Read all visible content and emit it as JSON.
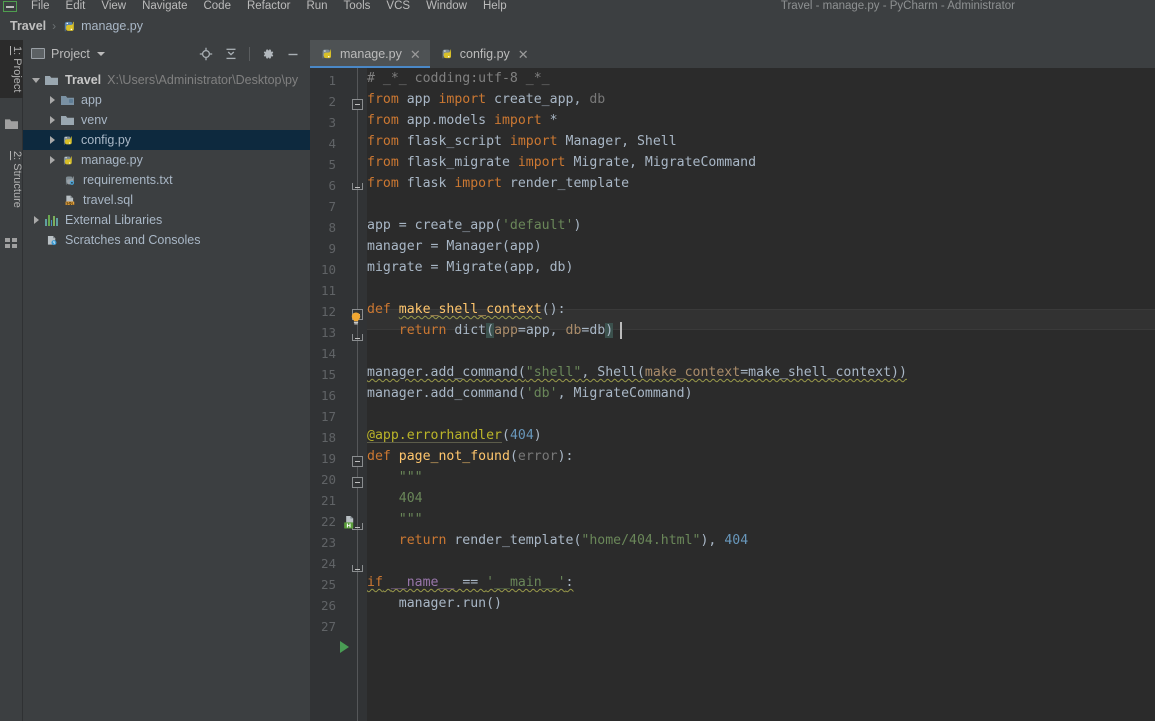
{
  "window": {
    "title": "Travel - manage.py - PyCharm - Administrator",
    "menu_items": [
      "File",
      "Edit",
      "View",
      "Navigate",
      "Code",
      "Refactor",
      "Run",
      "Tools",
      "VCS",
      "Window",
      "Help"
    ]
  },
  "breadcrumb": {
    "project": "Travel",
    "separator": "›",
    "file": "manage.py"
  },
  "tool_tabs": [
    {
      "number": "1:",
      "label": " Project",
      "active": true
    },
    {
      "number": "2:",
      "label": " Structure",
      "active": false
    }
  ],
  "project_panel": {
    "title": "Project",
    "actions": [
      {
        "name": "locate-icon",
        "tooltip": "Select Opened File"
      },
      {
        "name": "collapse-all-icon",
        "tooltip": "Collapse All"
      },
      {
        "name": "settings-gear-icon",
        "tooltip": "Settings"
      },
      {
        "name": "hide-icon",
        "tooltip": "Hide"
      }
    ],
    "tree": [
      {
        "label": "Travel",
        "path": "X:\\Users\\Administrator\\Desktop\\py",
        "icon": "folder-icon",
        "expanded": true,
        "depth": 0,
        "bold": true,
        "selected": false
      },
      {
        "label": "app",
        "icon": "module-folder-icon",
        "expanded": false,
        "depth": 1,
        "bold": false,
        "selected": false
      },
      {
        "label": "venv",
        "icon": "folder-icon",
        "expanded": false,
        "depth": 1,
        "bold": false,
        "selected": false
      },
      {
        "label": "config.py",
        "icon": "python-file-icon",
        "expanded": false,
        "depth": 1,
        "bold": false,
        "selected": true
      },
      {
        "label": "manage.py",
        "icon": "python-file-icon",
        "expanded": false,
        "depth": 1,
        "bold": false,
        "selected": false
      },
      {
        "label": "requirements.txt",
        "icon": "requirements-file-icon",
        "expanded": null,
        "depth": 1,
        "bold": false,
        "selected": false
      },
      {
        "label": "travel.sql",
        "icon": "sql-file-icon",
        "expanded": null,
        "depth": 1,
        "bold": false,
        "selected": false
      },
      {
        "label": "External Libraries",
        "icon": "library-icon",
        "expanded": false,
        "depth": 0,
        "bold": false,
        "selected": false
      },
      {
        "label": "Scratches and Consoles",
        "icon": "scratches-icon",
        "expanded": null,
        "depth": 0,
        "bold": false,
        "selected": false
      }
    ]
  },
  "editor": {
    "tabs": [
      {
        "label": "manage.py",
        "active": true,
        "icon": "python-file-icon"
      },
      {
        "label": "config.py",
        "active": false,
        "icon": "python-file-icon"
      }
    ],
    "line_numbers": [
      "1",
      "2",
      "3",
      "4",
      "5",
      "6",
      "7",
      "8",
      "9",
      "10",
      "11",
      "12",
      "13",
      "14",
      "15",
      "16",
      "17",
      "18",
      "19",
      "20",
      "21",
      "22",
      "23",
      "24",
      "25",
      "26",
      "27"
    ],
    "current_line": 13,
    "lines": [
      "# _*_ codding:utf-8 _*_",
      "from app import create_app, db",
      "from app.models import *",
      "from flask_script import Manager, Shell",
      "from flask_migrate import Migrate, MigrateCommand",
      "from flask import render_template",
      "",
      "app = create_app('default')",
      "manager = Manager(app)",
      "migrate = Migrate(app, db)",
      "",
      "def make_shell_context():",
      "    return dict(app=app, db=db)",
      "",
      "manager.add_command(\"shell\", Shell(make_context=make_shell_context))",
      "manager.add_command('db', MigrateCommand)",
      "",
      "@app.errorhandler(404)",
      "def page_not_found(error):",
      "    \"\"\"",
      "    404",
      "    \"\"\"",
      "    return render_template(\"home/404.html\"), 404",
      "",
      "if __name__ == '__main__':",
      "    manager.run()",
      ""
    ],
    "gutter_markers": [
      {
        "line": 13,
        "type": "intention-bulb-icon"
      },
      {
        "line": 19,
        "type": "flask-route-icon"
      },
      {
        "line": 25,
        "type": "run-gutter-icon"
      }
    ]
  },
  "colors": {
    "editor_bg": "#2b2b2b",
    "gutter_bg": "#313335",
    "panel_bg": "#3c3f41",
    "selection": "#0d293e",
    "tab_active": "#4e5254",
    "tab_underline": "#4a88c7",
    "keyword": "#cc7832",
    "string": "#6a8759",
    "number": "#6897bb",
    "function": "#ffc66d",
    "comment": "#808080",
    "decorator": "#bbb529",
    "text": "#a9b7c6"
  }
}
